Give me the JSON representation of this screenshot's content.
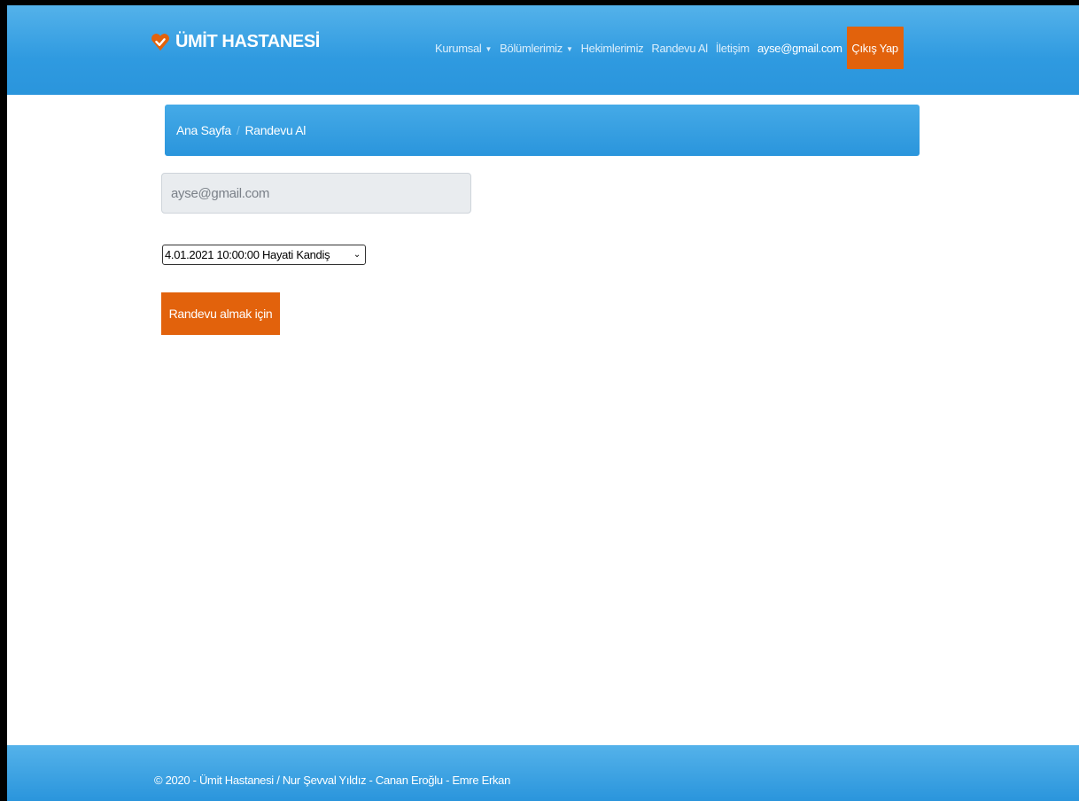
{
  "brand": {
    "name": "ÜMİT HASTANESİ",
    "icon": "heart-check-icon",
    "icon_color": "#e2620c"
  },
  "nav": {
    "items": [
      {
        "label": "Kurumsal",
        "dropdown": true
      },
      {
        "label": "Bölümlerimiz",
        "dropdown": true
      },
      {
        "label": "Hekimlerimiz",
        "dropdown": false
      },
      {
        "label": "Randevu Al",
        "dropdown": false
      },
      {
        "label": "İletişim",
        "dropdown": false
      }
    ],
    "user_email": "ayse@gmail.com",
    "logout_label": "Çıkış Yap"
  },
  "breadcrumb": {
    "home": "Ana Sayfa",
    "current": "Randevu Al"
  },
  "form": {
    "email_value": "ayse@gmail.com",
    "appointment_selected": "4.01.2021 10:00:00 Hayati Kandiş",
    "submit_label": "Randevu almak için"
  },
  "footer": {
    "text": "© 2020 - Ümit Hastanesi / Nur Şevval Yıldız - Canan Eroğlu - Emre Erkan"
  },
  "colors": {
    "header_blue": "#2f9ae0",
    "accent_orange": "#e2620c"
  }
}
